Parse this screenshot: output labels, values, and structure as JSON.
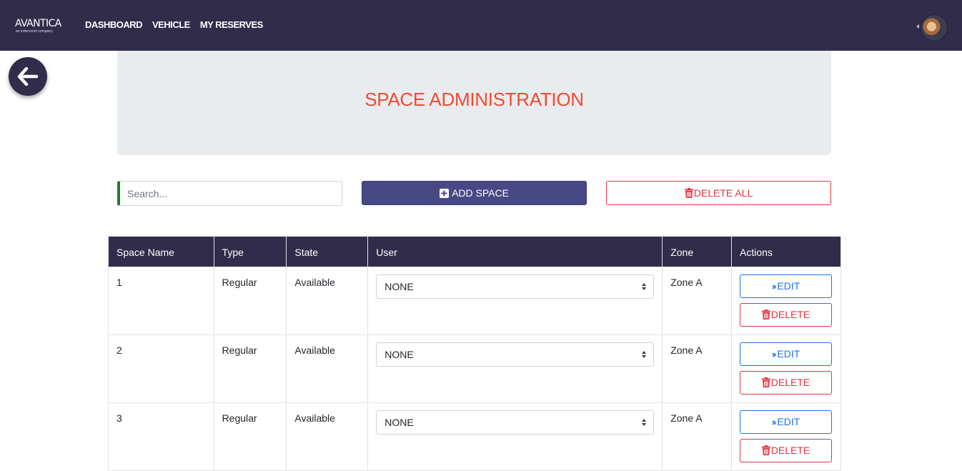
{
  "nav": {
    "logo_text": "AVANTICA",
    "logo_tagline": "an indecomm company",
    "links": [
      {
        "label": "DASHBOARD"
      },
      {
        "label": "VEHICLE"
      },
      {
        "label": "MY RESERVES"
      }
    ]
  },
  "header": {
    "title": "SPACE ADMINISTRATION"
  },
  "toolbar": {
    "search_placeholder": "Search...",
    "search_value": "",
    "add_label": "ADD SPACE",
    "delete_all_label": "DELETE ALL"
  },
  "table": {
    "columns": [
      "Space Name",
      "Type",
      "State",
      "User",
      "Zone",
      "Actions"
    ],
    "rows": [
      {
        "name": "1",
        "type": "Regular",
        "state": "Available",
        "user": "NONE",
        "zone": "Zone A",
        "edit": "EDIT",
        "delete": "DELETE"
      },
      {
        "name": "2",
        "type": "Regular",
        "state": "Available",
        "user": "NONE",
        "zone": "Zone A",
        "edit": "EDIT",
        "delete": "DELETE"
      },
      {
        "name": "3",
        "type": "Regular",
        "state": "Available",
        "user": "NONE",
        "zone": "Zone A",
        "edit": "EDIT",
        "delete": "DELETE"
      }
    ]
  },
  "colors": {
    "navbar": "#302c4a",
    "title": "#f04b30",
    "add_button": "#474884",
    "danger": "#dc3545",
    "edit": "#1a73e8",
    "search_accent": "#1e7e1e"
  }
}
